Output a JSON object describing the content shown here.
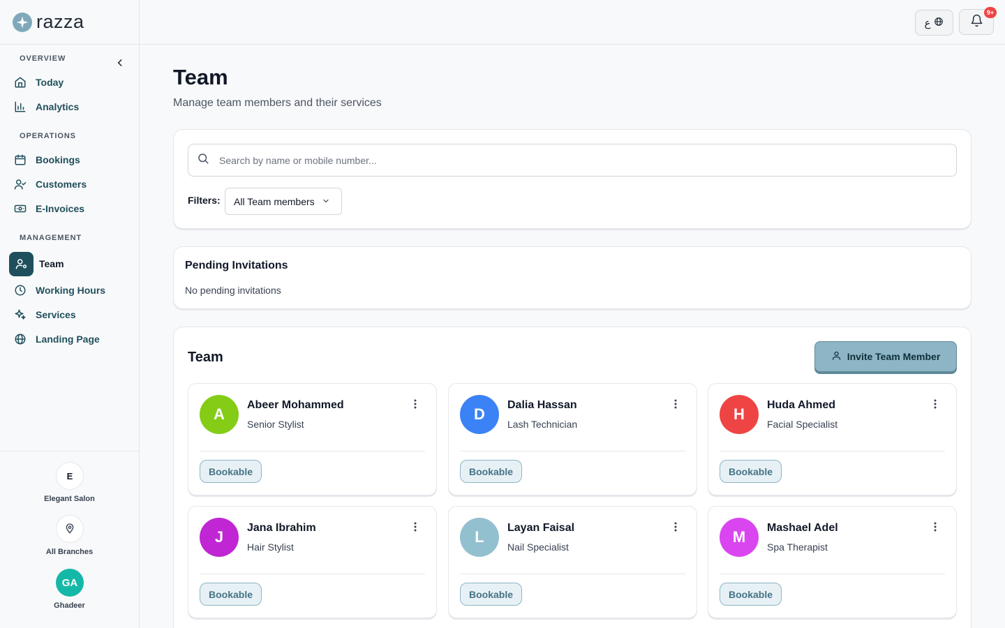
{
  "brand": {
    "name": "razza"
  },
  "sidebar": {
    "sections": [
      {
        "label": "OVERVIEW"
      },
      {
        "label": "OPERATIONS"
      },
      {
        "label": "MANAGEMENT"
      }
    ],
    "items": [
      {
        "label": "Today",
        "icon": "home-icon"
      },
      {
        "label": "Analytics",
        "icon": "bar-chart-icon"
      },
      {
        "label": "Bookings",
        "icon": "calendar-icon"
      },
      {
        "label": "Customers",
        "icon": "user-check-icon"
      },
      {
        "label": "E-Invoices",
        "icon": "banknote-icon"
      },
      {
        "label": "Team",
        "icon": "user-cog-icon",
        "active": true
      },
      {
        "label": "Working Hours",
        "icon": "clock-icon"
      },
      {
        "label": "Services",
        "icon": "sparkles-icon"
      },
      {
        "label": "Landing Page",
        "icon": "globe-icon"
      }
    ],
    "footer": {
      "salon_initial": "E",
      "salon_name": "Elegant Salon",
      "branches_label": "All Branches",
      "user_initials": "GA",
      "user_name": "Ghadeer"
    }
  },
  "topbar": {
    "lang_label": "ع",
    "notification_badge": "9+"
  },
  "page": {
    "title": "Team",
    "subtitle": "Manage team members and their services"
  },
  "search": {
    "placeholder": "Search by name or mobile number...",
    "value": ""
  },
  "filters": {
    "label": "Filters:",
    "selected": "All Team members"
  },
  "pending": {
    "title": "Pending Invitations",
    "empty_text": "No pending invitations"
  },
  "team": {
    "title": "Team",
    "invite_label": "Invite Team Member",
    "members": [
      {
        "initial": "A",
        "name": "Abeer Mohammed",
        "role": "Senior Stylist",
        "badge": "Bookable",
        "color": "#84cc16"
      },
      {
        "initial": "D",
        "name": "Dalia Hassan",
        "role": "Lash Technician",
        "badge": "Bookable",
        "color": "#3b82f6"
      },
      {
        "initial": "H",
        "name": "Huda Ahmed",
        "role": "Facial Specialist",
        "badge": "Bookable",
        "color": "#ef4444"
      },
      {
        "initial": "J",
        "name": "Jana Ibrahim",
        "role": "Hair Stylist",
        "badge": "Bookable",
        "color": "#c026d3"
      },
      {
        "initial": "L",
        "name": "Layan Faisal",
        "role": "Nail Specialist",
        "badge": "Bookable",
        "color": "#93c0cf"
      },
      {
        "initial": "M",
        "name": "Mashael Adel",
        "role": "Spa Therapist",
        "badge": "Bookable",
        "color": "#d946ef"
      }
    ]
  },
  "colors": {
    "accent": "#1f4f5c",
    "button": "#8db5c5",
    "badge_bg": "#e7f1f5"
  }
}
